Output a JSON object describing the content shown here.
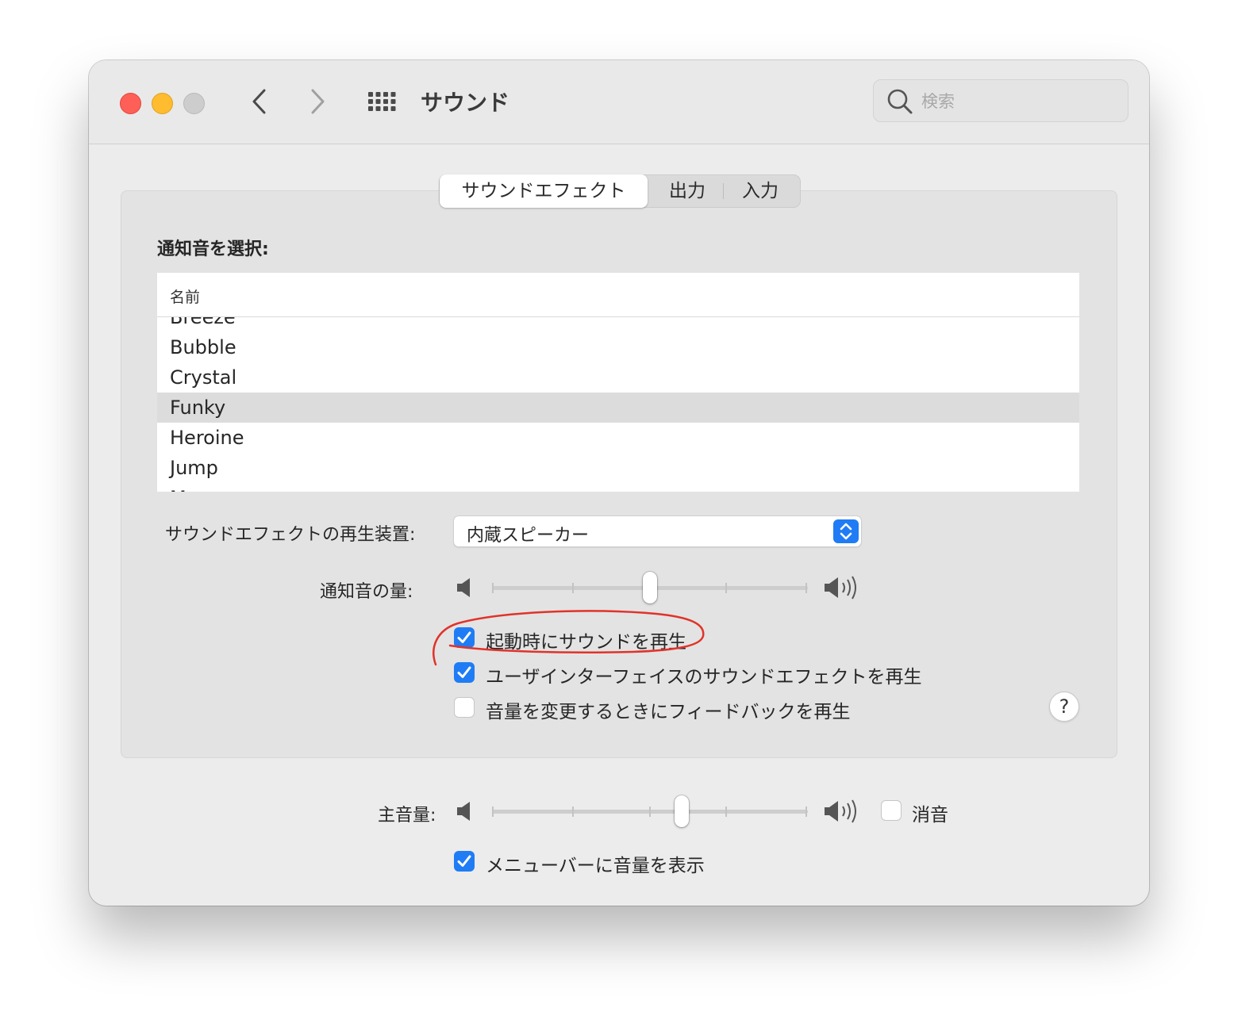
{
  "window": {
    "title": "サウンド",
    "search": {
      "placeholder": "検索",
      "value": ""
    }
  },
  "tabs": [
    {
      "label": "サウンドエフェクト",
      "active": true
    },
    {
      "label": "出力",
      "active": false
    },
    {
      "label": "入力",
      "active": false
    }
  ],
  "sound_effects": {
    "section_label": "通知音を選択:",
    "list": {
      "column_header": "名前",
      "items": [
        "Breeze",
        "Bubble",
        "Crystal",
        "Funky",
        "Heroine",
        "Jump",
        "Morse"
      ],
      "selected": "Funky"
    },
    "output_device": {
      "label": "サウンドエフェクトの再生装置:",
      "value": "内蔵スピーカー"
    },
    "alert_volume": {
      "label": "通知音の量:",
      "level": 0.5
    },
    "checkboxes": [
      {
        "label": "起動時にサウンドを再生",
        "checked": true
      },
      {
        "label": "ユーザインターフェイスのサウンドエフェクトを再生",
        "checked": true
      },
      {
        "label": "音量を変更するときにフィードバックを再生",
        "checked": false
      }
    ],
    "help_label": "?"
  },
  "output_volume": {
    "label": "主音量:",
    "level": 0.6,
    "mute": {
      "label": "消音",
      "checked": false
    }
  },
  "menubar_checkbox": {
    "label": "メニューバーに音量を表示",
    "checked": true
  },
  "colors": {
    "accent": "#1f7cf5",
    "close": "#fe5f57",
    "minimize": "#febc2e",
    "annotation": "#e0332a"
  },
  "icons": [
    "back-icon",
    "forward-icon",
    "grid-icon",
    "search-icon",
    "speaker-low-icon",
    "speaker-high-icon",
    "checkmark-icon",
    "stepper-icon"
  ]
}
